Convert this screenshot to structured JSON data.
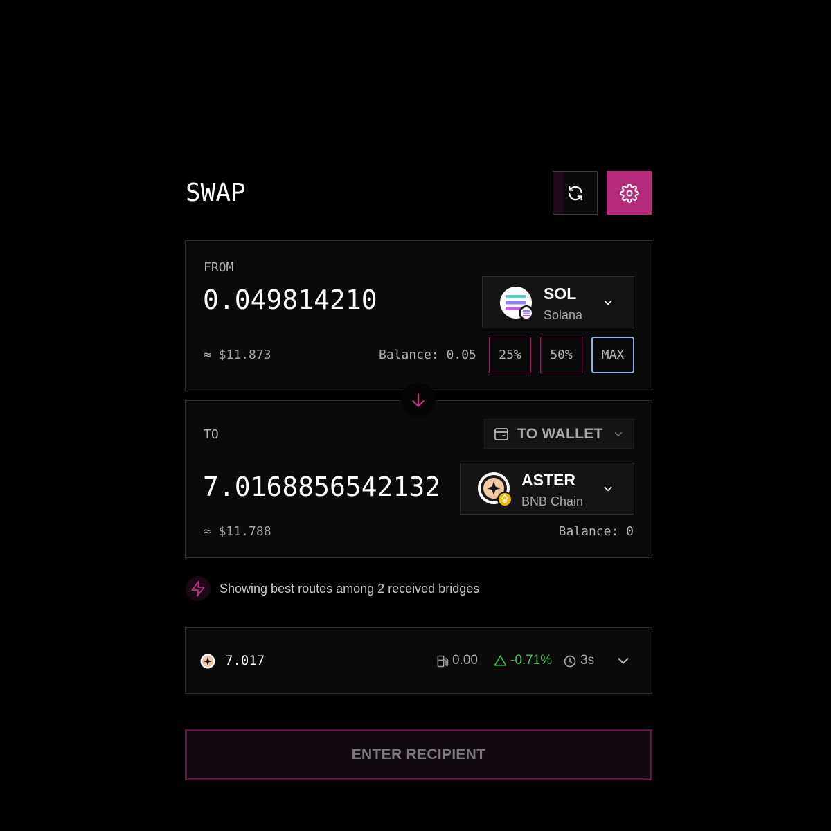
{
  "header": {
    "title": "SWAP"
  },
  "from": {
    "label": "FROM",
    "amount": "0.049814210",
    "usd": "≈ $11.873",
    "balance": "Balance: 0.05",
    "token": {
      "symbol": "SOL",
      "chain": "Solana",
      "icon": "solana-logo-icon"
    },
    "quick_amounts": [
      "25%",
      "50%",
      "MAX"
    ]
  },
  "to": {
    "label": "TO",
    "wallet_button": "TO WALLET",
    "amount": "7.0168856542132",
    "usd": "≈ $11.788",
    "balance": "Balance: 0",
    "token": {
      "symbol": "ASTER",
      "chain": "BNB Chain",
      "icon": "aster-logo-icon"
    }
  },
  "info": {
    "text": "Showing best routes among 2 received bridges"
  },
  "route": {
    "amount": "7.017",
    "gas": "0.00",
    "price_impact": "-0.71%",
    "time": "3s"
  },
  "cta": {
    "label": "ENTER RECIPIENT"
  },
  "colors": {
    "accent": "#b52b79",
    "positive": "#3ec25a",
    "max_border": "#8fb6e6"
  }
}
